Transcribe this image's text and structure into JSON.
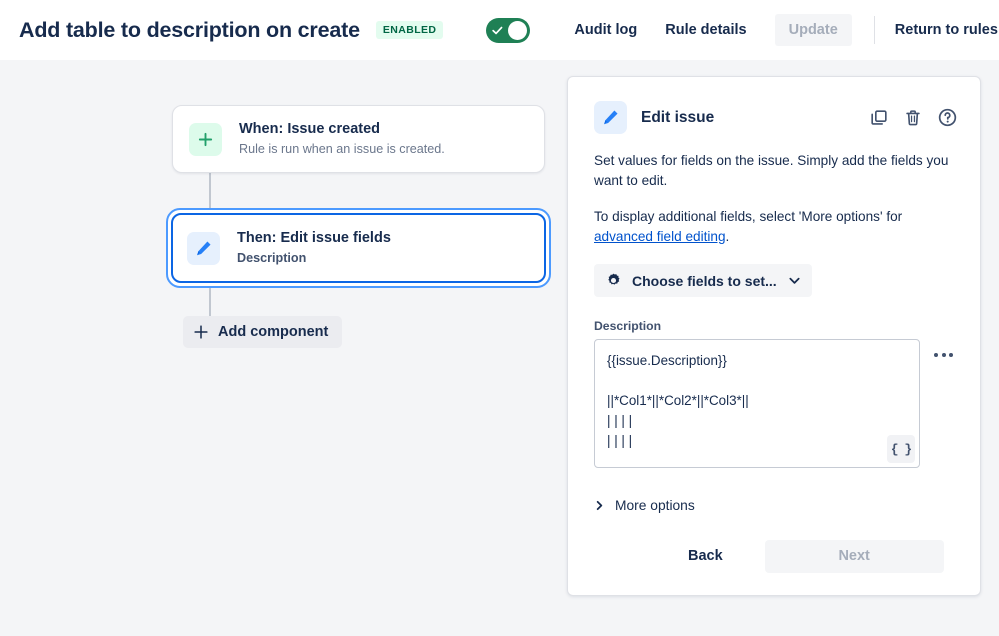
{
  "colors": {
    "accent_blue": "#0c66e4",
    "link_blue": "#0052cc",
    "toggle_green": "#1f8055",
    "badge_green_bg": "#e3fcef",
    "badge_green_text": "#006644",
    "text_navy": "#172b4d",
    "text_subtle": "#6b778c",
    "page_bg": "#f4f5f7"
  },
  "topbar": {
    "rule_title": "Add table to description on create",
    "status_badge": "ENABLED",
    "toggle_state": "on",
    "nav": [
      {
        "label": "Audit log",
        "name": "audit-log"
      },
      {
        "label": "Rule details",
        "name": "rule-details"
      }
    ],
    "update_button": "Update",
    "return_link": "Return to rules"
  },
  "canvas": {
    "cards": [
      {
        "title": "When: Issue created",
        "subtitle": "Rule is run when an issue is created.",
        "icon": "plus-icon",
        "selected": false
      },
      {
        "title": "Then: Edit issue fields",
        "subtitle": "Description",
        "icon": "pencil-icon",
        "selected": true
      }
    ],
    "add_component_label": "Add component"
  },
  "panel": {
    "icon": "pencil-icon",
    "title": "Edit issue",
    "actions": [
      {
        "name": "duplicate-icon",
        "label": "Duplicate"
      },
      {
        "name": "trash-icon",
        "label": "Delete"
      },
      {
        "name": "help-icon",
        "label": "Help"
      }
    ],
    "description_paragraph_1": "Set values for fields on the issue. Simply add the fields you want to edit.",
    "description_paragraph_2_before": "To display additional fields, select 'More options' for ",
    "description_link": "advanced field editing",
    "description_paragraph_2_after": ".",
    "choose_fields_label": "Choose fields to set...",
    "field_label": "Description",
    "field_value": "{{issue.Description}}\n\n||*Col1*||*Col2*||*Col3*||\n| | | |\n| | | |",
    "smart_value_button": "{ }",
    "more_options_label": "More options",
    "back_label": "Back",
    "next_label": "Next"
  }
}
